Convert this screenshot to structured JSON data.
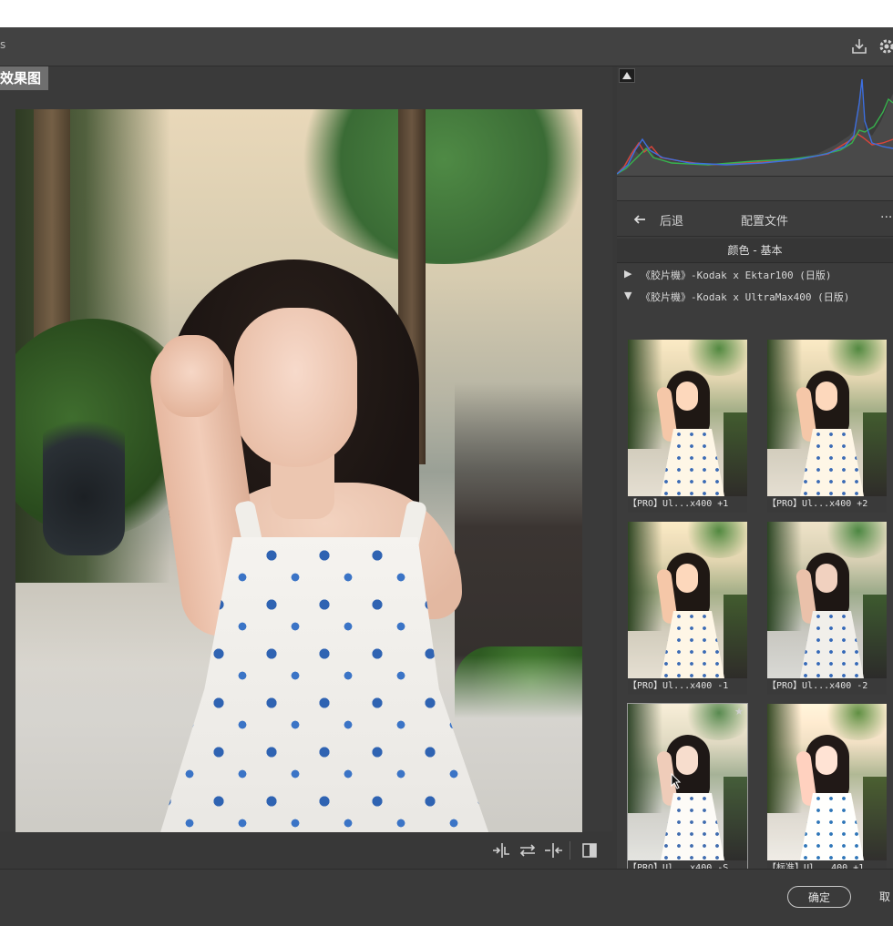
{
  "window": {
    "title_fragment": "s"
  },
  "toolbar": {
    "save_icon": "save-icon",
    "settings_icon": "gear-icon"
  },
  "preview": {
    "label": "效果图"
  },
  "bottom_tools": {
    "items": [
      "compare-left-icon",
      "swap-icon",
      "compare-right-icon",
      "split-view-icon"
    ]
  },
  "histogram": {
    "colors": {
      "red": "#d9443a",
      "green": "#37b24d",
      "blue": "#3d6fe0"
    }
  },
  "profile_browser": {
    "back_label": "后退",
    "title": "配置文件",
    "more": "···",
    "group_title": "颜色 - 基本",
    "profiles": [
      {
        "caret": "▶",
        "name": "《胶片機》-Kodak x Ektar100 (日版)"
      },
      {
        "caret": "▼",
        "name": "《胶片機》-Kodak x UltraMax400 (日版)"
      }
    ],
    "thumbnails": [
      {
        "label": "【PRO】Ul...x400 +1"
      },
      {
        "label": "【PRO】Ul...x400 +2"
      },
      {
        "label": "【PRO】Ul...x400 -1"
      },
      {
        "label": "【PRO】Ul...x400 -2"
      },
      {
        "label": "【PRO】Ul...x400 -S"
      },
      {
        "label": "【标准】Ul...400 +1"
      }
    ],
    "star": "★"
  },
  "footer": {
    "ok_label": "确定",
    "cancel_label": "取"
  }
}
